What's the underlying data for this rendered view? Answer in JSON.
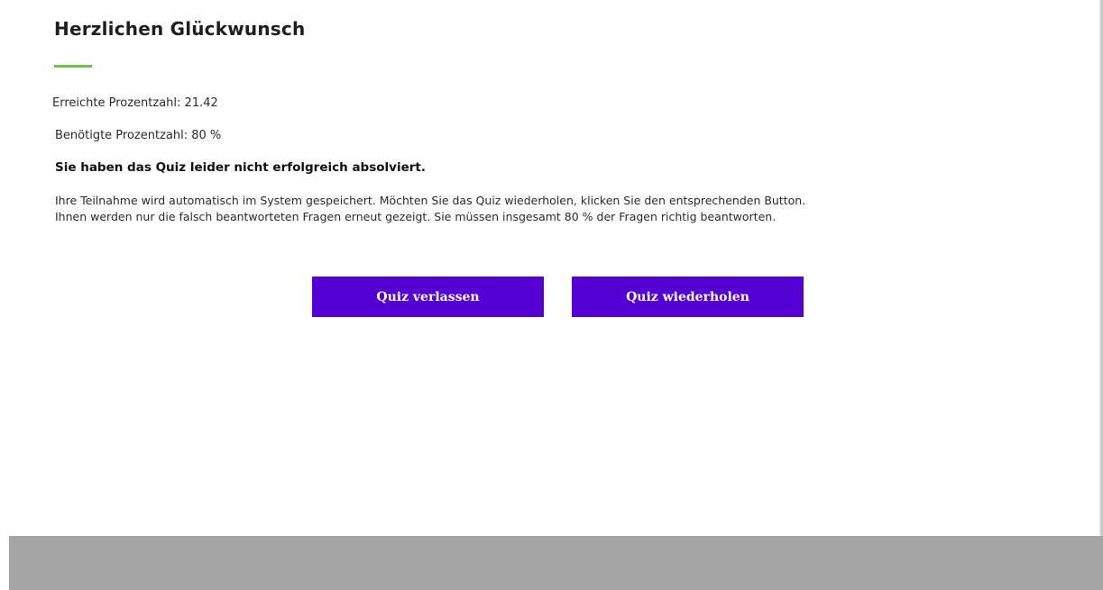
{
  "header": {
    "title": "Herzlichen Glückwunsch"
  },
  "score": {
    "achieved_label": "Erreichte Prozentzahl: 21.42",
    "required_label": "Benötigte Prozentzahl: 80 %"
  },
  "result": {
    "message": "Sie haben das Quiz leider nicht erfolgreich absolviert."
  },
  "info": {
    "line1": "Ihre Teilnahme wird automatisch im System gespeichert. Möchten Sie das Quiz wiederholen, klicken Sie den entsprechenden Button.",
    "line2": "Ihnen werden nur die falsch beantworteten Fragen erneut gezeigt. Sie müssen insgesamt 80 % der Fragen richtig beantworten."
  },
  "actions": {
    "leave_label": "Quiz verlassen",
    "retry_label": "Quiz wiederholen"
  },
  "colors": {
    "accent_green": "#6cc24a",
    "button_purple": "#5500d4",
    "footer_gray": "#a5a5a5"
  }
}
